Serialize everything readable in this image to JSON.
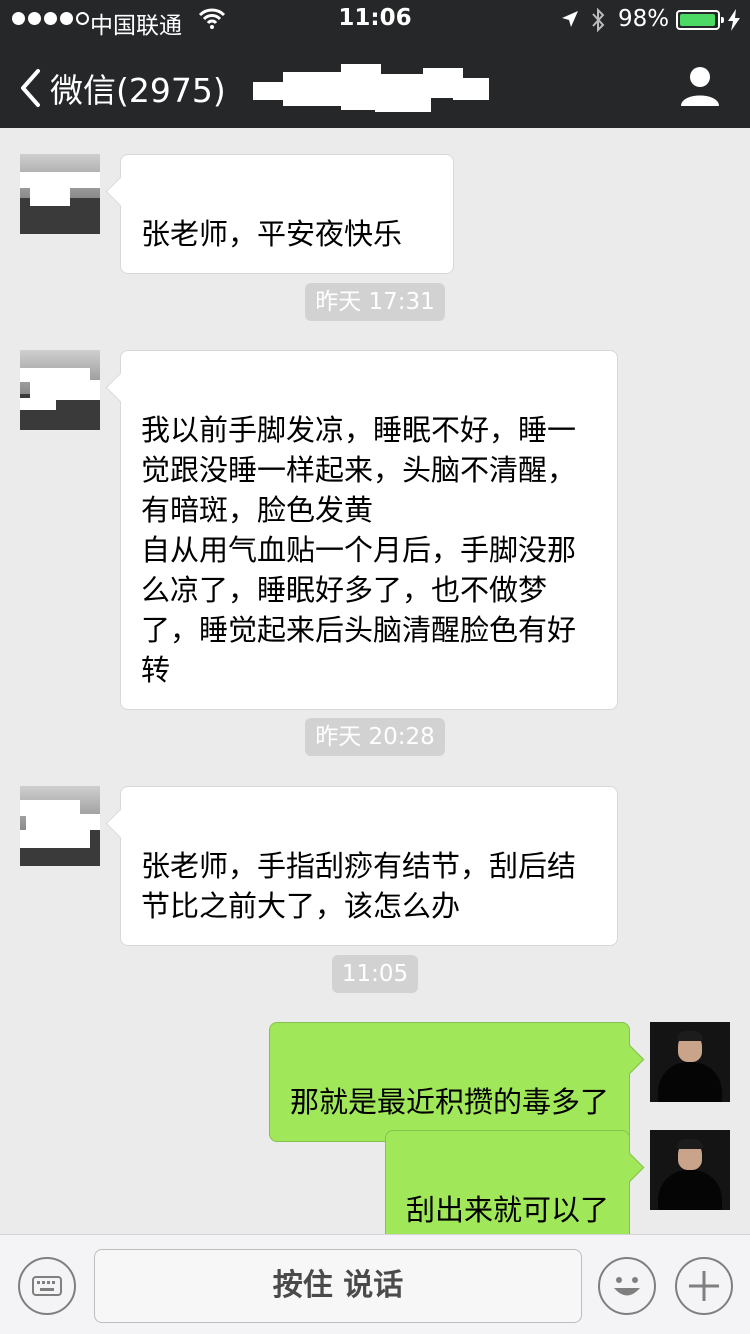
{
  "status_bar": {
    "carrier": "中国联通",
    "time": "11:06",
    "battery_percent": "98%",
    "battery_level": 0.98
  },
  "nav": {
    "back_label": "微信(2975)",
    "back_icon": "chevron-left-icon",
    "profile_icon": "person-icon"
  },
  "messages": [
    {
      "side": "in",
      "text": "张老师，平安夜快乐"
    },
    {
      "timestamp": "昨天 17:31"
    },
    {
      "side": "in",
      "text": "我以前手脚发凉，睡眠不好，睡一觉跟没睡一样起来，头脑不清醒，有暗斑，脸色发黄\n自从用气血贴一个月后，手脚没那么凉了，睡眠好多了，也不做梦了，睡觉起来后头脑清醒脸色有好转"
    },
    {
      "timestamp": "昨天 20:28"
    },
    {
      "side": "in",
      "text": "张老师，手指刮痧有结节，刮后结节比之前大了，该怎么办"
    },
    {
      "timestamp": "11:05"
    },
    {
      "side": "out",
      "text": "那就是最近积攒的毒多了"
    },
    {
      "side": "out",
      "text": "刮出来就可以了"
    }
  ],
  "input_bar": {
    "voice_button_label": "按住 说话",
    "keyboard_icon": "keyboard-icon",
    "emoji_icon": "emoji-icon",
    "plus_icon": "plus-icon"
  },
  "colors": {
    "nav_bg": "#262729",
    "chat_bg": "#ebebeb",
    "bubble_out": "#a0e75a",
    "bubble_in": "#ffffff",
    "battery": "#4cd964"
  }
}
